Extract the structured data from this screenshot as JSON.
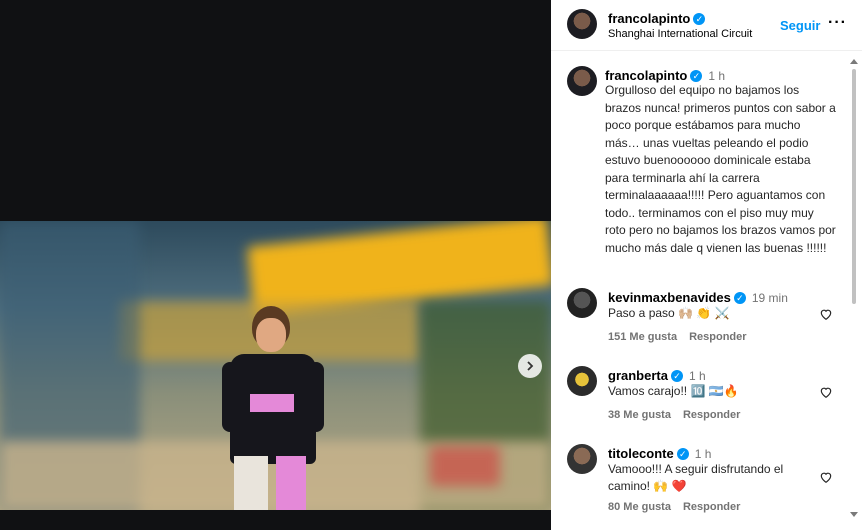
{
  "post": {
    "username": "francolapinto",
    "location": "Shanghai International Circuit",
    "follow_label": "Seguir",
    "more_label": "•••",
    "caption_time": "1 h",
    "caption": "Orgulloso del equipo no bajamos los brazos nunca! primeros puntos con sabor a poco porque estábamos para mucho más… unas vueltas peleando el podio estuvo buenoooooo dominicale estaba para terminarla ahí la carrera terminalaaaaaa!!!!! Pero aguantamos con todo.. terminamos con el piso muy muy roto pero no bajamos los brazos vamos por mucho más dale q vienen las buenas !!!!!!"
  },
  "comments": [
    {
      "username": "kevinmaxbenavides",
      "time": "19 min",
      "text": "Paso a paso 🙌🏼 👏 ⚔️",
      "likes": "151 Me gusta",
      "reply": "Responder"
    },
    {
      "username": "granberta",
      "time": "1 h",
      "text": "Vamos carajo!! 🔟 🇦🇷🔥",
      "likes": "38 Me gusta",
      "reply": "Responder"
    },
    {
      "username": "titoleconte",
      "time": "1 h",
      "text": "Vamooo!!! A seguir disfrutando el camino! 🙌 ❤️",
      "likes": "80 Me gusta",
      "reply": "Responder"
    }
  ],
  "icons": {
    "verified": "verified-badge-icon",
    "next": "chevron-right-icon",
    "like": "heart-icon"
  },
  "colors": {
    "accent": "#0095f6",
    "meta": "#737373"
  }
}
